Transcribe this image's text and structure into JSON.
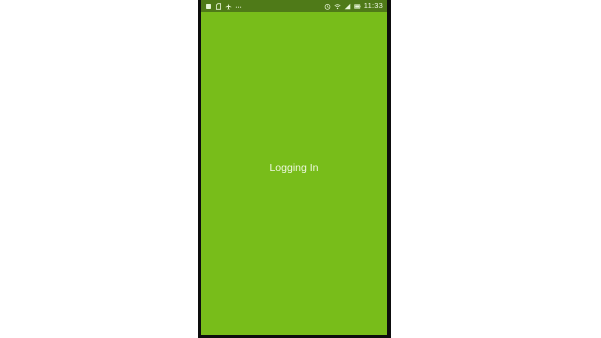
{
  "status_bar": {
    "left_icons": [
      "notification-icon",
      "sim-icon",
      "airplane-icon",
      "more-dots-icon"
    ],
    "right_icons": [
      "alarm-icon",
      "wifi-icon",
      "signal-icon",
      "battery-icon"
    ],
    "time": "11:33"
  },
  "screen": {
    "message": "Logging In",
    "background_color": "#78bd1a"
  }
}
